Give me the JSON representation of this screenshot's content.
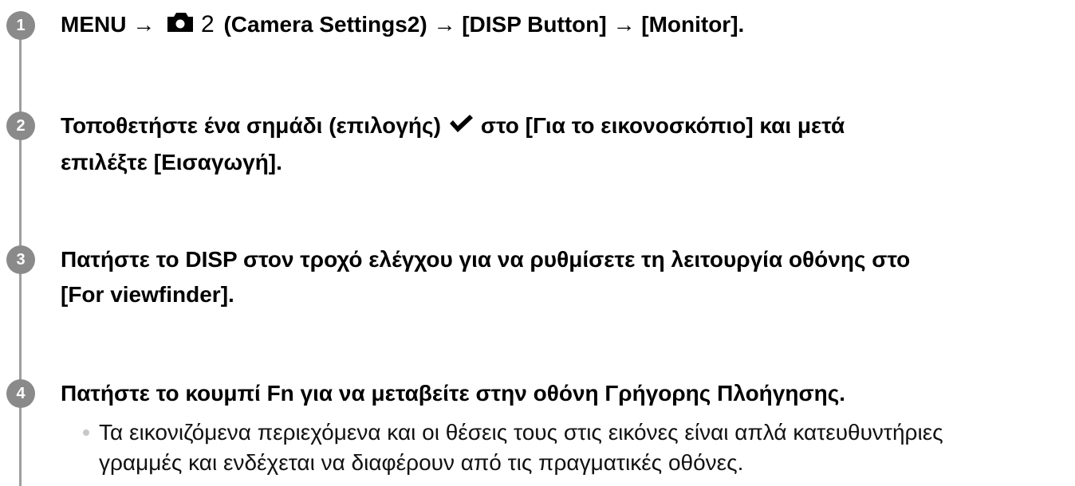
{
  "steps": [
    {
      "number": "1",
      "parts": {
        "menu_prefix": "MENU →",
        "camera_icon": "camera-icon",
        "icon_suffix": "2",
        "rest": "(Camera Settings2) → [DISP Button] → [Monitor]."
      }
    },
    {
      "number": "2",
      "parts": {
        "before_check": "Τοποθετήστε ένα σημάδι (επιλογής)",
        "check_icon": "checkmark-icon",
        "after_check": "στο [Για το εικονοσκόπιο] και μετά",
        "line2": "επιλέξτε [Εισαγωγή]."
      }
    },
    {
      "number": "3",
      "parts": {
        "line1": "Πατήστε το DISP στον τροχό ελέγχου για να ρυθμίσετε τη λειτουργία οθόνης στο",
        "line2": "[For viewfinder]."
      }
    },
    {
      "number": "4",
      "parts": {
        "line1": "Πατήστε το κουμπί Fn για να μεταβείτε στην οθόνη Γρήγορης Πλοήγησης."
      },
      "note": {
        "line1": "Τα εικονιζόμενα περιεχόμενα και οι θέσεις τους στις εικόνες είναι απλά κατευθυντήριες",
        "line2": "γραμμές και ενδέχεται να διαφέρουν από τις πραγματικές οθόνες."
      }
    }
  ],
  "colors": {
    "badge": "#8a8a8a",
    "timeline": "#9e9e9e",
    "bullet": "#c8c8c8",
    "text": "#000000"
  }
}
